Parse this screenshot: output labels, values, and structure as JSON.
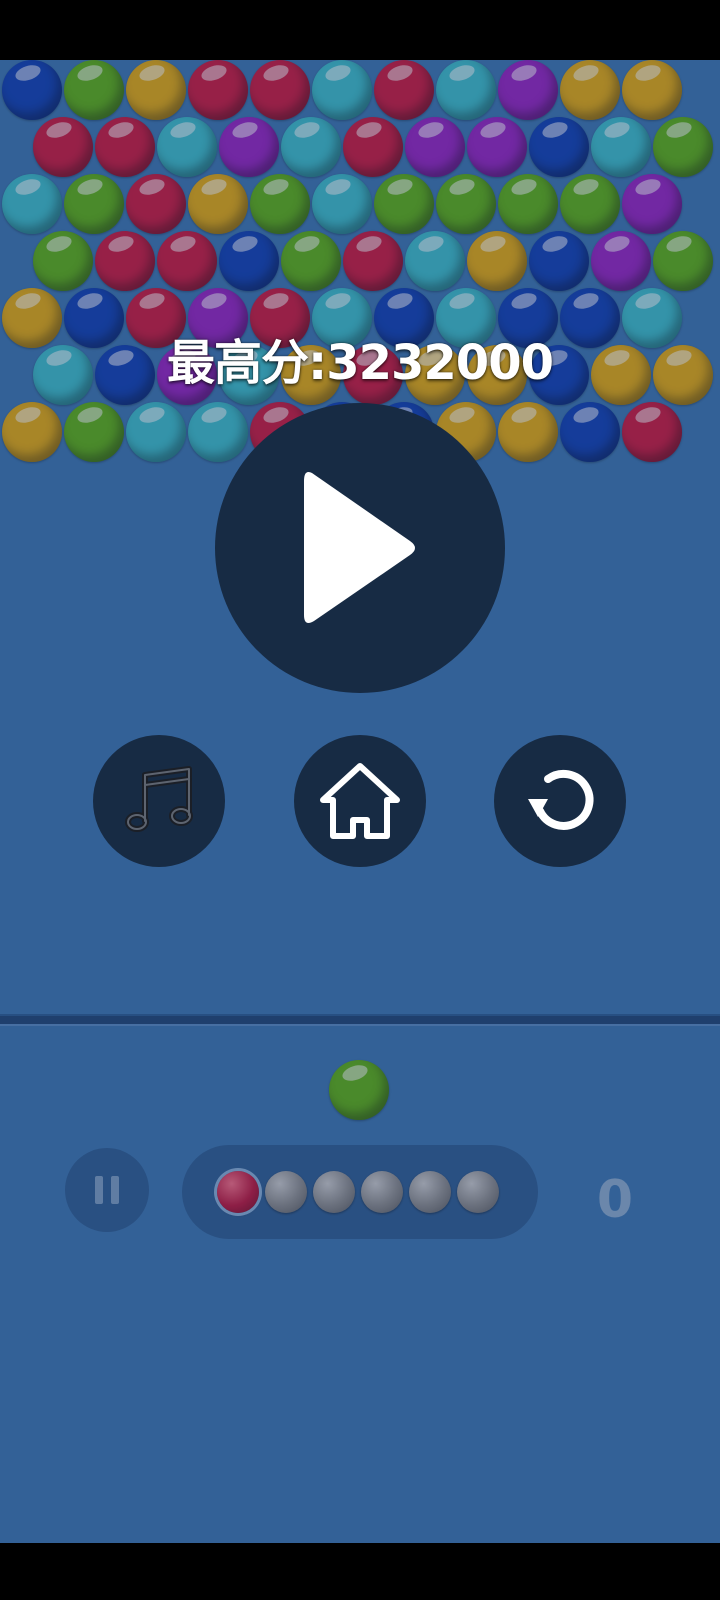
{
  "high_score": {
    "label": "最高分:3232000"
  },
  "buttons": {
    "play": "play-icon",
    "music": "music-note-icon",
    "home": "home-icon",
    "restart": "restart-icon",
    "pause": "pause-icon"
  },
  "score": {
    "value": "0"
  },
  "palette": {
    "R": "#d0193f",
    "G": "#5fb415",
    "Y": "#e9ae10",
    "B": "#1142b8",
    "C": "#3ec2cf",
    "P": "#9a24c6"
  },
  "board": {
    "rows": [
      [
        "B",
        "G",
        "Y",
        "R",
        "R",
        "C",
        "R",
        "C",
        "P",
        "Y",
        "Y"
      ],
      [
        "R",
        "R",
        "C",
        "P",
        "C",
        "R",
        "P",
        "P",
        "B",
        "C",
        "G"
      ],
      [
        "C",
        "G",
        "R",
        "Y",
        "G",
        "C",
        "G",
        "G",
        "G",
        "G",
        "P"
      ],
      [
        "G",
        "R",
        "R",
        "B",
        "G",
        "R",
        "C",
        "Y",
        "B",
        "P",
        "G"
      ],
      [
        "Y",
        "B",
        "R",
        "P",
        "R",
        "C",
        "B",
        "C",
        "B",
        "B",
        "C"
      ],
      [
        "C",
        "B",
        "P",
        "C",
        "Y",
        "R",
        "Y",
        "Y",
        "B",
        "Y",
        "Y"
      ],
      [
        "Y",
        "G",
        "C",
        "C",
        "R",
        "B",
        "B",
        "Y",
        "Y",
        "B",
        "R"
      ]
    ]
  },
  "shooter": {
    "current_color": "G"
  },
  "queue": {
    "colors": [
      "R",
      "grey",
      "grey",
      "grey",
      "grey",
      "grey"
    ],
    "active_index": 0
  }
}
